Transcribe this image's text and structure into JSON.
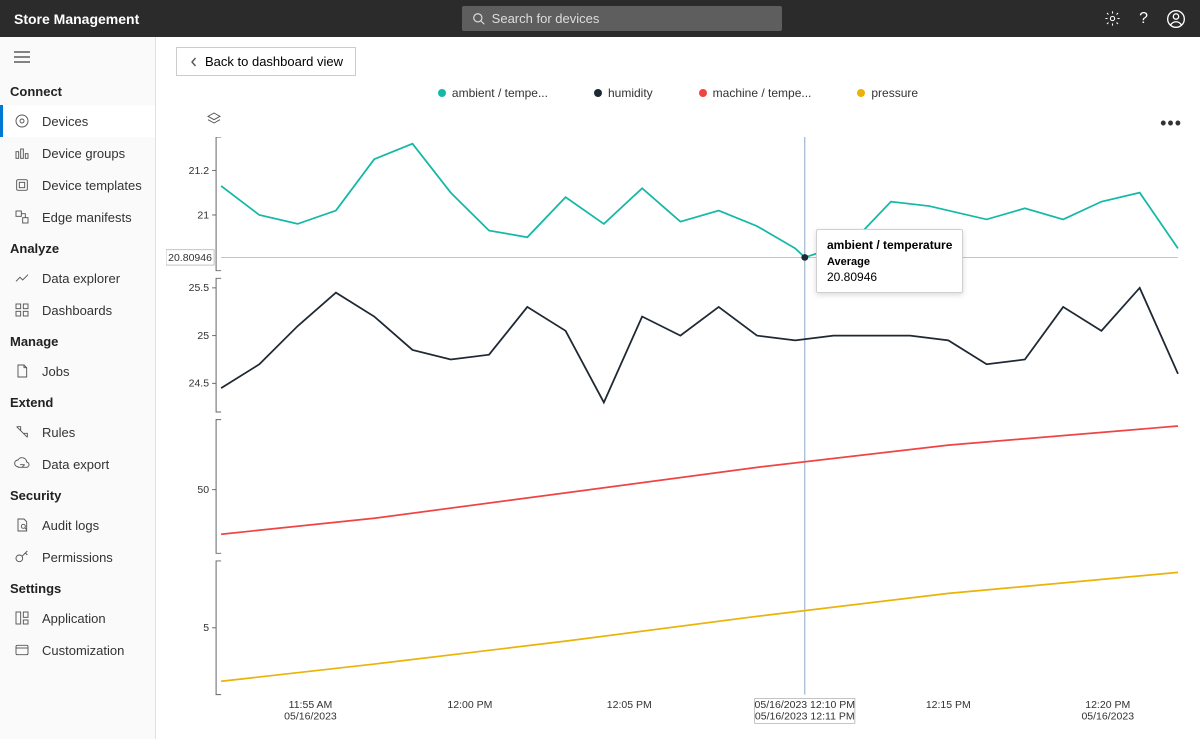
{
  "app_title": "Store Management",
  "search": {
    "placeholder": "Search for devices"
  },
  "back_button": "Back to dashboard view",
  "sidebar": {
    "sections": [
      {
        "header": "Connect",
        "items": [
          {
            "label": "Devices",
            "active": true
          },
          {
            "label": "Device groups"
          },
          {
            "label": "Device templates"
          },
          {
            "label": "Edge manifests"
          }
        ]
      },
      {
        "header": "Analyze",
        "items": [
          {
            "label": "Data explorer"
          },
          {
            "label": "Dashboards"
          }
        ]
      },
      {
        "header": "Manage",
        "items": [
          {
            "label": "Jobs"
          }
        ]
      },
      {
        "header": "Extend",
        "items": [
          {
            "label": "Rules"
          },
          {
            "label": "Data export"
          }
        ]
      },
      {
        "header": "Security",
        "items": [
          {
            "label": "Audit logs"
          },
          {
            "label": "Permissions"
          }
        ]
      },
      {
        "header": "Settings",
        "items": [
          {
            "label": "Application"
          },
          {
            "label": "Customization"
          }
        ]
      }
    ]
  },
  "legend": [
    {
      "label": "ambient / tempe...",
      "color": "#14b8a6"
    },
    {
      "label": "humidity",
      "color": "#1f2933"
    },
    {
      "label": "machine / tempe...",
      "color": "#ef4444"
    },
    {
      "label": "pressure",
      "color": "#eab308"
    }
  ],
  "tooltip": {
    "title": "ambient / temperature",
    "label": "Average",
    "value": "20.80946"
  },
  "hover_time": {
    "line1": "05/16/2023 12:10 PM",
    "line2": "05/16/2023 12:11 PM"
  },
  "hover_y_value": "20.80946",
  "chart_data": {
    "type": "line",
    "xlabel": "",
    "ylabel": "",
    "x_ticks": [
      {
        "t": 11.9167,
        "label1": "11:55 AM",
        "label2": "05/16/2023"
      },
      {
        "t": 12.0,
        "label1": "12:00 PM",
        "label2": ""
      },
      {
        "t": 12.0833,
        "label1": "12:05 PM",
        "label2": ""
      },
      {
        "t": 12.25,
        "label1": "12:15 PM",
        "label2": ""
      },
      {
        "t": 12.3333,
        "label1": "12:20 PM",
        "label2": "05/16/2023"
      }
    ],
    "x_range": [
      11.87,
      12.37
    ],
    "hover_x": 12.175,
    "panes": [
      {
        "y_ticks": [
          21,
          21.2
        ],
        "ylim": [
          20.75,
          21.35
        ],
        "series": [
          {
            "name": "ambient / temperature",
            "color": "#14b8a6",
            "x": [
              11.87,
              11.89,
              11.91,
              11.93,
              11.95,
              11.97,
              11.99,
              12.01,
              12.03,
              12.05,
              12.07,
              12.09,
              12.11,
              12.13,
              12.15,
              12.17,
              12.175,
              12.2,
              12.22,
              12.24,
              12.27,
              12.29,
              12.31,
              12.33,
              12.35,
              12.37
            ],
            "y": [
              21.13,
              21.0,
              20.96,
              21.02,
              21.25,
              21.32,
              21.1,
              20.93,
              20.9,
              21.08,
              20.96,
              21.12,
              20.97,
              21.02,
              20.95,
              20.85,
              20.80946,
              20.88,
              21.06,
              21.04,
              20.98,
              21.03,
              20.98,
              21.06,
              21.1,
              20.85
            ]
          }
        ],
        "hover_y": 20.80946
      },
      {
        "y_ticks": [
          24.5,
          25,
          25.5
        ],
        "ylim": [
          24.2,
          25.6
        ],
        "series": [
          {
            "name": "humidity",
            "color": "#1f2933",
            "x": [
              11.87,
              11.89,
              11.91,
              11.93,
              11.95,
              11.97,
              11.99,
              12.01,
              12.03,
              12.05,
              12.07,
              12.09,
              12.11,
              12.13,
              12.15,
              12.17,
              12.19,
              12.21,
              12.23,
              12.25,
              12.27,
              12.29,
              12.31,
              12.33,
              12.35,
              12.37
            ],
            "y": [
              24.45,
              24.7,
              25.1,
              25.45,
              25.2,
              24.85,
              24.75,
              24.8,
              25.3,
              25.05,
              24.3,
              25.2,
              25.0,
              25.3,
              25.0,
              24.95,
              25.0,
              25.0,
              25.0,
              24.95,
              24.7,
              24.75,
              25.3,
              25.05,
              25.5,
              24.6
            ]
          }
        ]
      },
      {
        "y_ticks": [
          50
        ],
        "ylim": [
          30,
          72
        ],
        "series": [
          {
            "name": "machine / temperature",
            "color": "#ef4444",
            "x": [
              11.87,
              11.95,
              12.05,
              12.15,
              12.25,
              12.37
            ],
            "y": [
              36,
              41,
              49,
              57,
              64,
              70
            ]
          }
        ]
      },
      {
        "y_ticks": [
          5
        ],
        "ylim": [
          1.5,
          8.5
        ],
        "series": [
          {
            "name": "pressure",
            "color": "#eab308",
            "x": [
              11.87,
              11.95,
              12.05,
              12.15,
              12.25,
              12.37
            ],
            "y": [
              2.2,
              3.1,
              4.3,
              5.6,
              6.8,
              7.9
            ]
          }
        ]
      }
    ]
  }
}
